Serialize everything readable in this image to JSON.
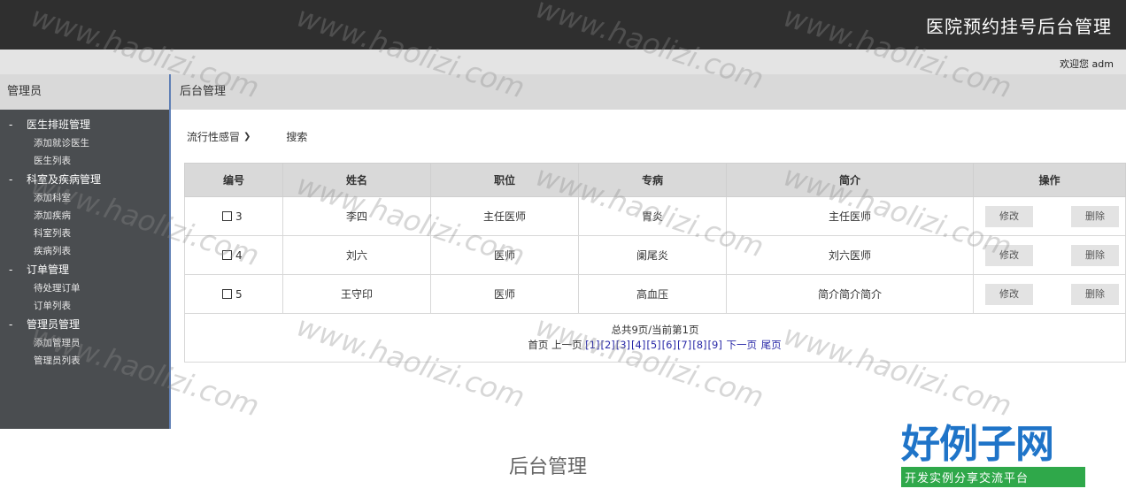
{
  "app_title": "医院预约挂号后台管理",
  "welcome": "欢迎您 adm",
  "sidebar": {
    "header": "管理员",
    "groups": [
      {
        "label": "医生排班管理",
        "items": [
          "添加就诊医生",
          "医生列表"
        ]
      },
      {
        "label": "科室及疾病管理",
        "items": [
          "添加科室",
          "添加疾病",
          "科室列表",
          "疾病列表"
        ]
      },
      {
        "label": "订单管理",
        "items": [
          "待处理订单",
          "订单列表"
        ]
      },
      {
        "label": "管理员管理",
        "items": [
          "添加管理员",
          "管理员列表"
        ]
      }
    ]
  },
  "main": {
    "header": "后台管理",
    "filter": {
      "selected": "流行性感冒",
      "search_label": "搜索"
    },
    "table": {
      "columns": [
        "编号",
        "姓名",
        "职位",
        "专病",
        "简介",
        "操作"
      ],
      "rows": [
        {
          "id": "3",
          "name": "李四",
          "position": "主任医师",
          "specialty": "胃炎",
          "intro": "主任医师"
        },
        {
          "id": "4",
          "name": "刘六",
          "position": "医师",
          "specialty": "阑尾炎",
          "intro": "刘六医师"
        },
        {
          "id": "5",
          "name": "王守印",
          "position": "医师",
          "specialty": "高血压",
          "intro": "简介简介简介"
        }
      ],
      "edit_label": "修改",
      "delete_label": "删除"
    },
    "pagination": {
      "summary": "总共9页/当前第1页",
      "first": "首页",
      "prev": "上一页",
      "pages": [
        "[1]",
        "[2]",
        "[3]",
        "[4]",
        "[5]",
        "[6]",
        "[7]",
        "[8]",
        "[9]"
      ],
      "next": "下一页",
      "last": "尾页"
    }
  },
  "caption": "后台管理",
  "logo": {
    "main": "好例子网",
    "sub": "开发实例分享交流平台"
  },
  "watermark": "www.haolizi.com",
  "colors": {
    "topbar": "#2f2f2f",
    "sidebar": "#4a4d50",
    "link": "#2a2aa8",
    "logo_blue": "#1f74c8",
    "logo_green": "#2fa84a"
  }
}
